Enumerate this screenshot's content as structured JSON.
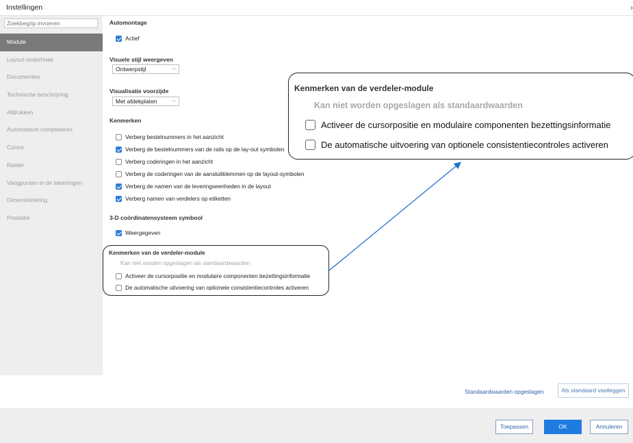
{
  "window": {
    "title": "Instellingen",
    "close_glyph": "›"
  },
  "search": {
    "placeholder": "Zoekbegrip invoeren"
  },
  "sidebar": {
    "items": [
      {
        "label": "Module",
        "active": true
      },
      {
        "label": "Layout onderhoek"
      },
      {
        "label": "Documenten"
      },
      {
        "label": "Technische beschrijving"
      },
      {
        "label": "Afdrukken"
      },
      {
        "label": "Automatisch completeren"
      },
      {
        "label": "Cursor"
      },
      {
        "label": "Raster"
      },
      {
        "label": "Vangpunten in de tekeningen"
      },
      {
        "label": "Dimensionering"
      },
      {
        "label": "Prestatie"
      }
    ]
  },
  "automontage": {
    "heading": "Automontage",
    "actief_label": "Actief",
    "actief_checked": true
  },
  "visuele_stijl": {
    "heading": "Visuele stijl weergeven",
    "value": "Ontwerpstijl"
  },
  "visualisatie": {
    "heading": "Visualisatie voorzijde",
    "value": "Met afdekplaten"
  },
  "kenmerken": {
    "heading": "Kenmerken",
    "items": [
      {
        "label": "Verberg bestelnummers in het aanzicht",
        "checked": false
      },
      {
        "label": "Verberg de bestelnummers van de rails op de lay-out symbolen",
        "checked": true
      },
      {
        "label": "Verberg coderingen in het aanzicht",
        "checked": false
      },
      {
        "label": "Verberg de coderingen van de aansluitklemmen op de layout-symbolen",
        "checked": false
      },
      {
        "label": "Verberg de namen van de leveringseenheden in de layout",
        "checked": true
      },
      {
        "label": "Verberg namen van verdelers op etiketten",
        "checked": true
      }
    ]
  },
  "coord": {
    "heading": "3-D coördinatensysteem symbool",
    "label": "Weergegeven",
    "checked": true
  },
  "verdeler": {
    "heading": "Kenmerken van de verdeler-module",
    "subtitle": "Kan niet worden opgeslagen als standaardwaarden",
    "items": [
      {
        "label": "Activeer de cursorpositie en modulaire componenten bezettingsinformatie",
        "checked": false
      },
      {
        "label": "De automatische uitvoering van optionele consistentiecontroles activeren",
        "checked": false
      }
    ]
  },
  "actions": {
    "save_defaults_link": "Standaardwaarden opgeslagen",
    "set_default_button": "Als standaard vastleggen",
    "apply": "Toepassen",
    "ok": "OK",
    "cancel": "Annuleren"
  },
  "colors": {
    "accent": "#2e7cd4",
    "ok_button": "#1f7be0",
    "sidebar_active": "#7a7a7a",
    "sidebar_bg": "#eeeeee"
  }
}
